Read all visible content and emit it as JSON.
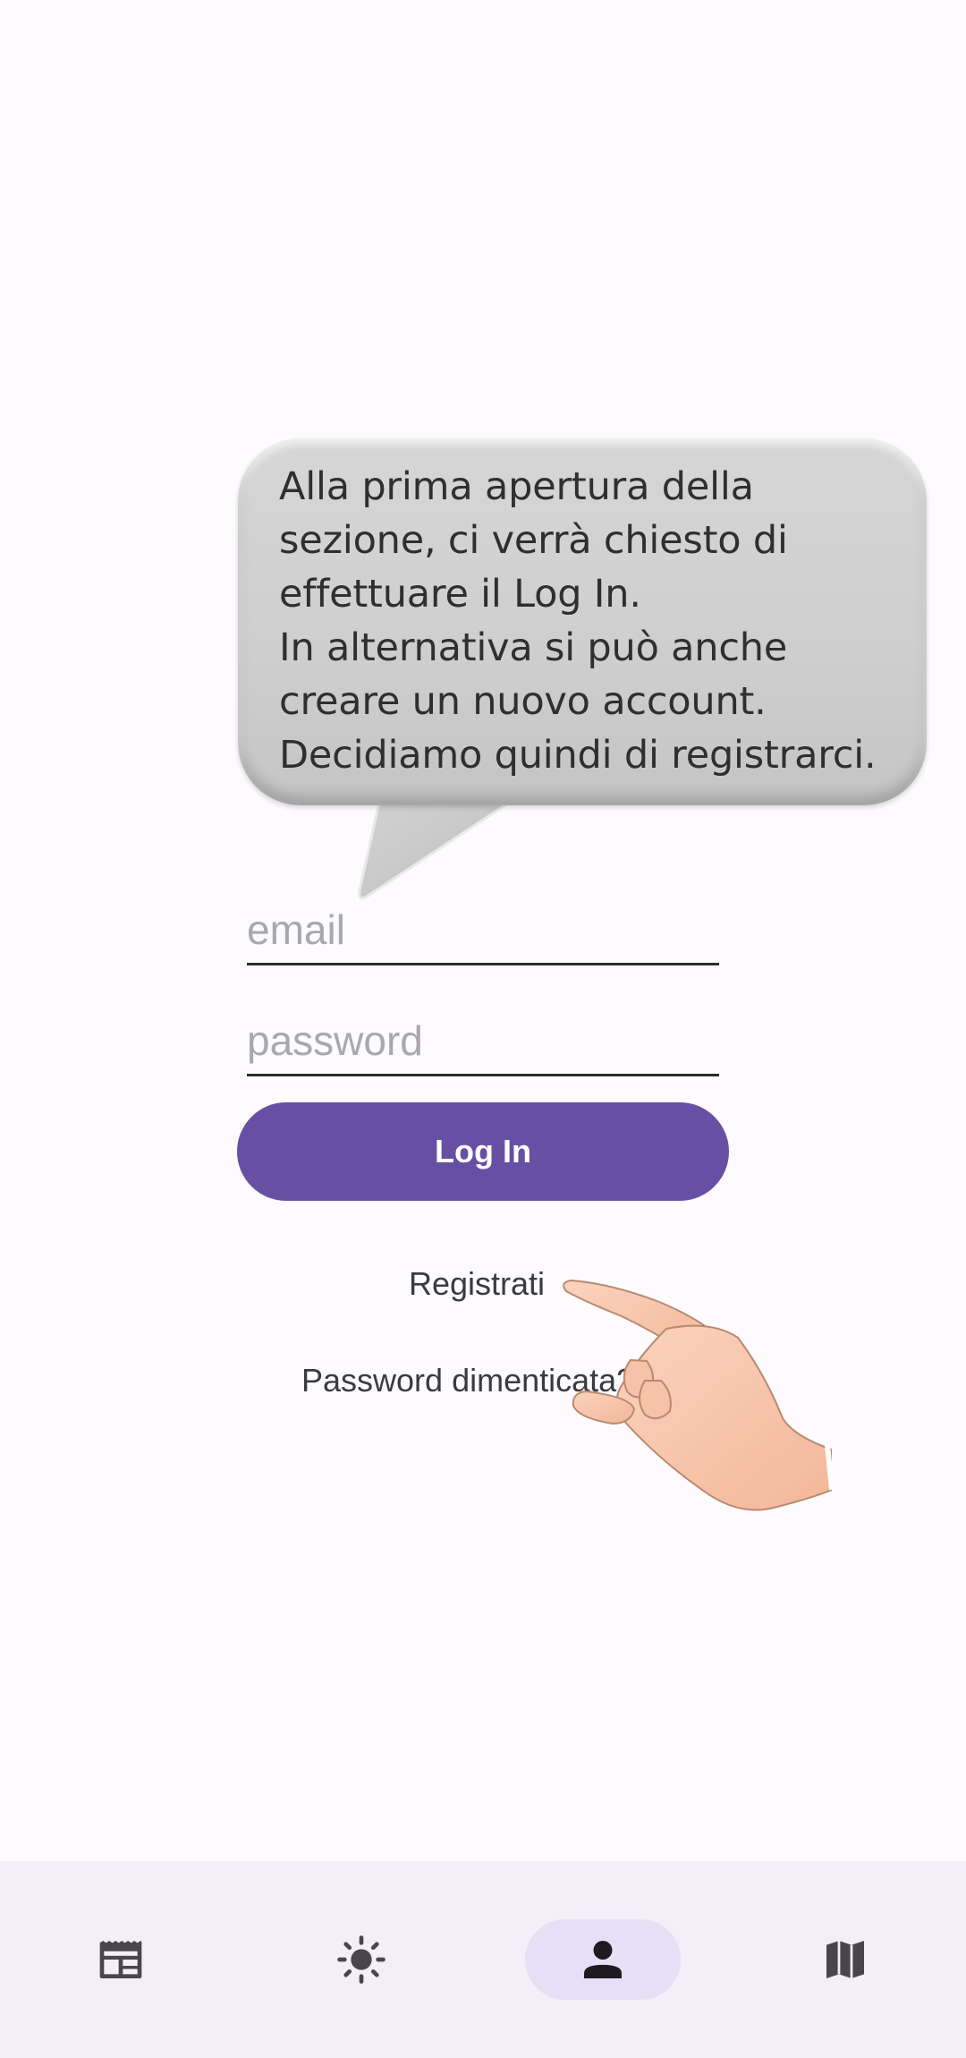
{
  "tutorial": {
    "bubble_lines": [
      "Alla prima apertura della",
      "sezione, ci verrà chiesto di",
      "effettuare il Log In.",
      "In alternativa si può anche",
      "creare un nuovo account.",
      "Decidiamo quindi di registrarci."
    ]
  },
  "login": {
    "email_placeholder": "email",
    "password_placeholder": "password",
    "login_button": "Log In",
    "register_link": "Registrati",
    "forgot_password_link": "Password dimenticata?"
  },
  "bottom_nav": {
    "items": [
      {
        "icon": "newspaper-icon",
        "active": false
      },
      {
        "icon": "sun-icon",
        "active": false
      },
      {
        "icon": "person-icon",
        "active": true
      },
      {
        "icon": "map-icon",
        "active": false
      }
    ]
  },
  "colors": {
    "primary": "#6750a4",
    "nav_background": "#f3eef7",
    "nav_active_pill": "#e7dff6",
    "background": "#fdfbfd"
  }
}
